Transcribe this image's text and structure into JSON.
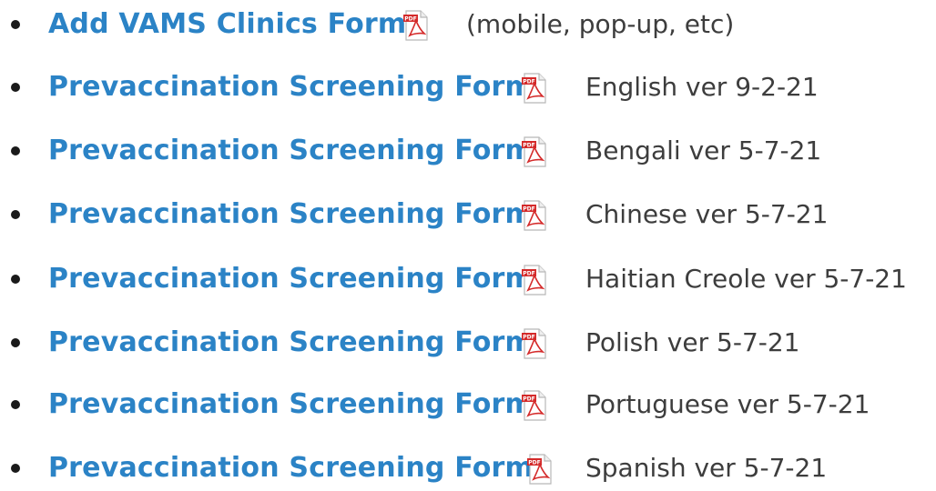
{
  "items": [
    {
      "link": "Add VAMS Clinics Form",
      "note": "(mobile, pop-up, etc)",
      "icon": "pdf-file-icon"
    },
    {
      "link": "Prevaccination Screening Form",
      "note": "English ver 9-2-21",
      "icon": "pdf-file-icon"
    },
    {
      "link": "Prevaccination Screening Form",
      "note": "Bengali ver 5-7-21",
      "icon": "pdf-file-icon"
    },
    {
      "link": "Prevaccination Screening Form",
      "note": "Chinese ver 5-7-21",
      "icon": "pdf-file-icon"
    },
    {
      "link": "Prevaccination Screening Form",
      "note": "Haitian Creole ver 5-7-21",
      "icon": "pdf-file-icon"
    },
    {
      "link": "Prevaccination Screening Form",
      "note": "Polish ver 5-7-21",
      "icon": "pdf-file-icon"
    },
    {
      "link": "Prevaccination Screening Form",
      "note": "Portuguese ver 5-7-21",
      "icon": "pdf-file-icon"
    },
    {
      "link": "Prevaccination Screening Form",
      "note": "Spanish ver 5-7-21",
      "icon": "pdf-file-icon"
    }
  ],
  "colors": {
    "link": "#2b83c6",
    "note": "#3d3d3d",
    "pdf_icon_red": "#d42a2a"
  }
}
